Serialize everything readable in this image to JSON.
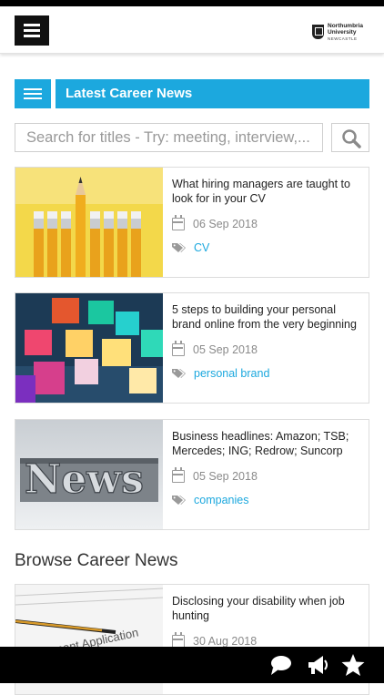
{
  "header": {
    "logo": {
      "line1": "Northumbria",
      "line2": "University",
      "line3": "NEWCASTLE"
    }
  },
  "section": {
    "title": "Latest Career News"
  },
  "search": {
    "placeholder": "Search for titles - Try: meeting, interview,..."
  },
  "news": [
    {
      "title": "What hiring managers are taught to look for in your CV",
      "date": "06 Sep 2018",
      "tag": "CV",
      "image": "pencils-image"
    },
    {
      "title": "5 steps to building your personal brand online from the very beginning",
      "date": "05 Sep 2018",
      "tag": "personal brand",
      "image": "blocks-image"
    },
    {
      "title": "Business headlines: Amazon; TSB; Mercedes; ING; Redrow; Suncorp",
      "date": "05 Sep 2018",
      "tag": "companies",
      "image": "news-letters-image"
    }
  ],
  "browse": {
    "title": "Browse Career News",
    "items": [
      {
        "title": "Disclosing your disability when job hunting",
        "date": "30 Aug 2018",
        "image": "application-form-image"
      }
    ]
  },
  "colors": {
    "accent": "#1ca8de",
    "bar": "#000000"
  },
  "bottom_nav": {
    "icons": [
      "chat-icon",
      "megaphone-icon",
      "star-icon"
    ]
  }
}
